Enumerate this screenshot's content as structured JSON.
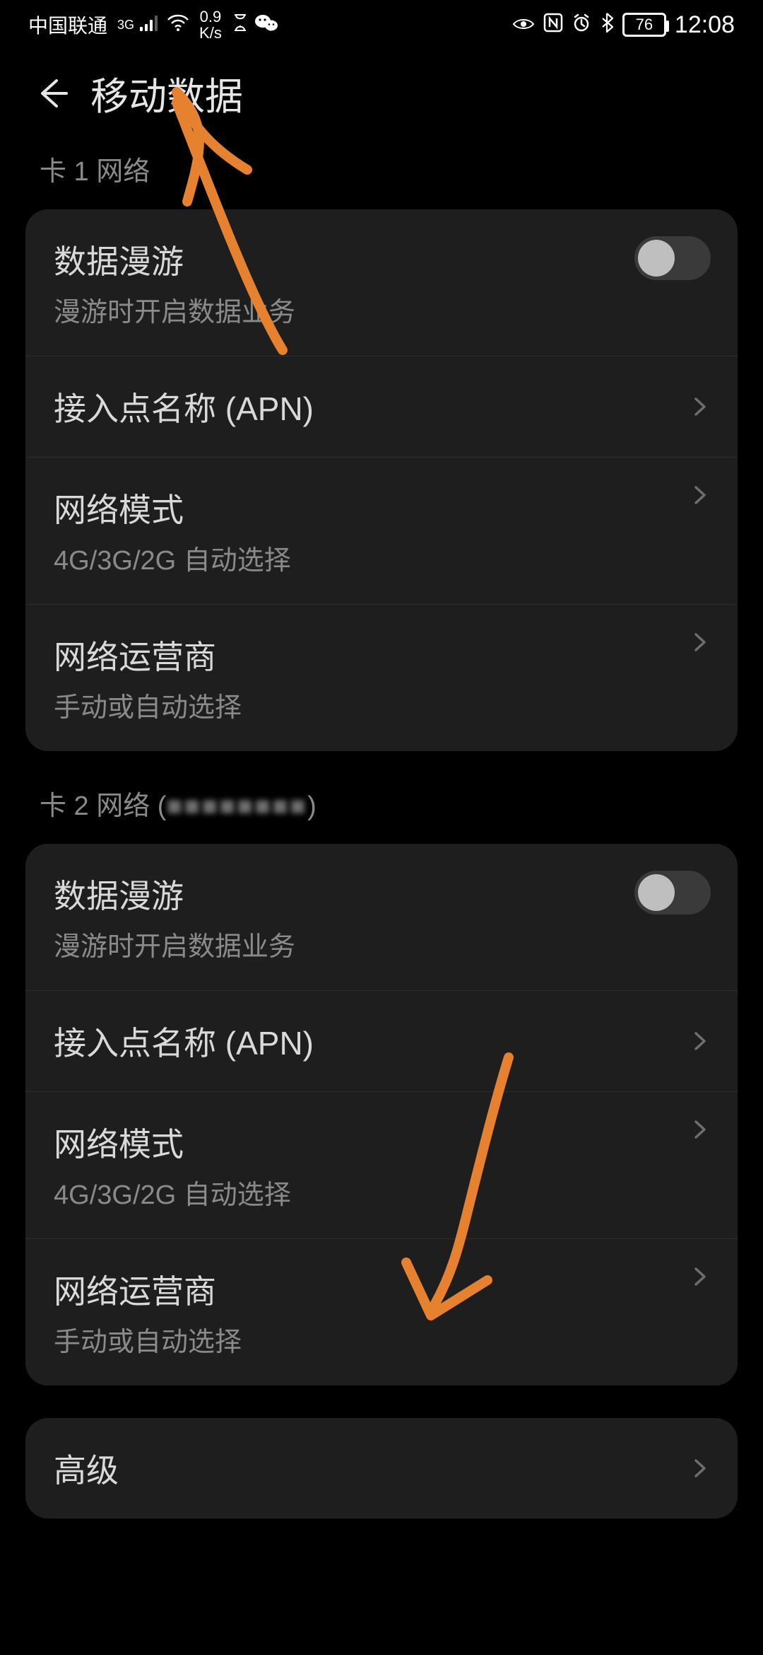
{
  "status_bar": {
    "carrier": "中国联通",
    "network_gen": "3G",
    "net_speed_value": "0.9",
    "net_speed_unit": "K/s",
    "battery_percent": "76",
    "time": "12:08"
  },
  "header": {
    "title": "移动数据"
  },
  "sections": [
    {
      "label": "卡 1 网络",
      "rows": [
        {
          "title": "数据漫游",
          "subtitle": "漫游时开启数据业务",
          "trailing": "toggle",
          "toggle_on": false
        },
        {
          "title": "接入点名称 (APN)",
          "subtitle": "",
          "trailing": "chevron"
        },
        {
          "title": "网络模式",
          "subtitle": "4G/3G/2G 自动选择",
          "trailing": "chevron"
        },
        {
          "title": "网络运营商",
          "subtitle": "手动或自动选择",
          "trailing": "chevron"
        }
      ]
    },
    {
      "label": "卡 2 网络 (",
      "label_redacted": "■■■■■■■■",
      "label_tail": ")",
      "rows": [
        {
          "title": "数据漫游",
          "subtitle": "漫游时开启数据业务",
          "trailing": "toggle",
          "toggle_on": false
        },
        {
          "title": "接入点名称 (APN)",
          "subtitle": "",
          "trailing": "chevron"
        },
        {
          "title": "网络模式",
          "subtitle": "4G/3G/2G 自动选择",
          "trailing": "chevron"
        },
        {
          "title": "网络运营商",
          "subtitle": "手动或自动选择",
          "trailing": "chevron"
        }
      ]
    }
  ],
  "advanced": {
    "label": "高级"
  },
  "annotations": {
    "color": "#e6812f"
  }
}
